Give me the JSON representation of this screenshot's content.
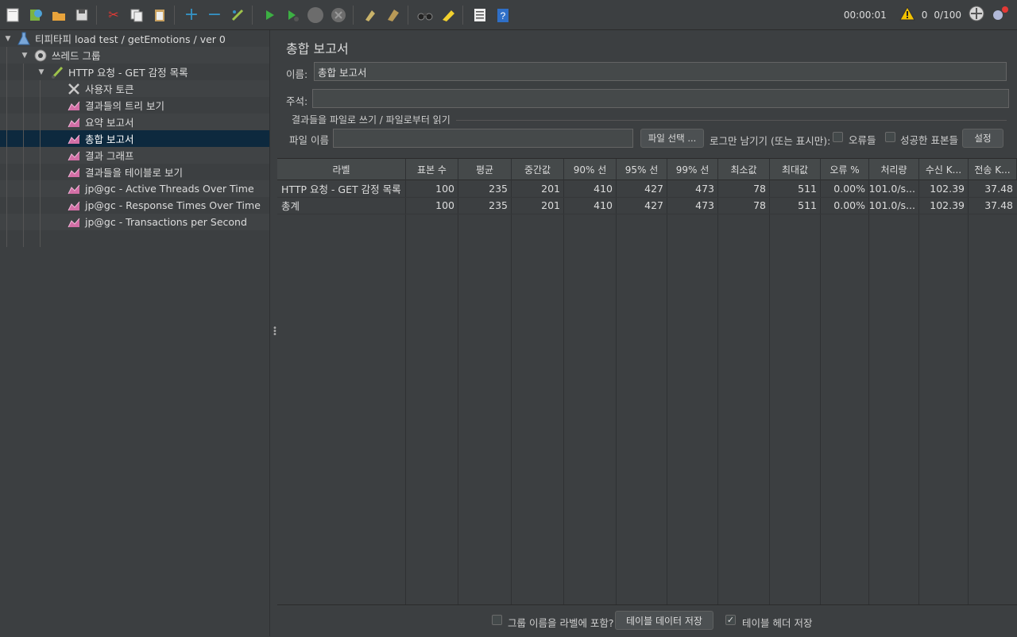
{
  "toolbar": {
    "icons": [
      "new-icon",
      "templates-icon",
      "open-icon",
      "save-icon",
      "cut-icon",
      "copy-icon",
      "paste-icon",
      "expand-icon",
      "collapse-icon",
      "toggle-icon",
      "start-icon",
      "start-no-pause-icon",
      "stop-icon",
      "shutdown-icon",
      "clear-icon",
      "clear-all-icon",
      "search-icon",
      "reset-search-icon",
      "function-helper-icon",
      "help-icon"
    ],
    "elapsed": "00:00:01",
    "warnings": "0",
    "threads": "0/100"
  },
  "tree": [
    {
      "label": "티피타피 load test / getEmotions / ver 0",
      "icon": "test-plan-icon",
      "level": 0,
      "expanded": true
    },
    {
      "label": "쓰레드 그룹",
      "icon": "thread-group-icon",
      "level": 1,
      "expanded": true
    },
    {
      "label": "HTTP 요청 - GET 감정 목록",
      "icon": "http-sampler-icon",
      "level": 2,
      "expanded": true
    },
    {
      "label": "사용자 토큰",
      "icon": "config-tools-icon",
      "level": 3
    },
    {
      "label": "결과들의 트리 보기",
      "icon": "listener-icon",
      "level": 3
    },
    {
      "label": "요약 보고서",
      "icon": "listener-icon",
      "level": 3
    },
    {
      "label": "총합 보고서",
      "icon": "listener-icon",
      "level": 3,
      "selected": true
    },
    {
      "label": "결과 그래프",
      "icon": "listener-icon",
      "level": 3
    },
    {
      "label": "결과들을 테이블로 보기",
      "icon": "listener-icon",
      "level": 3
    },
    {
      "label": "jp@gc - Active Threads Over Time",
      "icon": "listener-icon",
      "level": 3
    },
    {
      "label": "jp@gc - Response Times Over Time",
      "icon": "listener-icon",
      "level": 3
    },
    {
      "label": "jp@gc - Transactions per Second",
      "icon": "listener-icon",
      "level": 3
    }
  ],
  "panel": {
    "title": "총합 보고서",
    "name_label": "이름:",
    "name_value": "총합 보고서",
    "comment_label": "주석:",
    "comment_value": "",
    "file_group_title": "결과들을 파일로 쓰기 / 파일로부터 읽기",
    "file_label": "파일 이름",
    "file_value": "",
    "browse_button": "파일 선택 ...",
    "log_only_label": "로그만 남기기 (또는 표시만):",
    "errors_label": "오류들",
    "success_label": "성공한 표본들",
    "configure_button": "설정"
  },
  "table": {
    "columns": [
      "라벨",
      "표본 수",
      "평균",
      "중간값",
      "90% 선",
      "95% 선",
      "99% 선",
      "최소값",
      "최대값",
      "오류 %",
      "처리량",
      "수신 K...",
      "전송 K..."
    ],
    "rows": [
      [
        "HTTP 요청 - GET 감정 목록",
        "100",
        "235",
        "201",
        "410",
        "427",
        "473",
        "78",
        "511",
        "0.00%",
        "101.0/s...",
        "102.39",
        "37.48"
      ],
      [
        "총계",
        "100",
        "235",
        "201",
        "410",
        "427",
        "473",
        "78",
        "511",
        "0.00%",
        "101.0/s...",
        "102.39",
        "37.48"
      ]
    ]
  },
  "bottom": {
    "include_group_label": "그룹 이름을 라벨에 포함?",
    "include_group_checked": false,
    "save_table_button": "테이블 데이터 저장",
    "save_header_label": "테이블 헤더 저장",
    "save_header_checked": true
  },
  "colors": {
    "background": "#3c3f41",
    "selection": "#0d293e",
    "accent": "#3592c4"
  }
}
